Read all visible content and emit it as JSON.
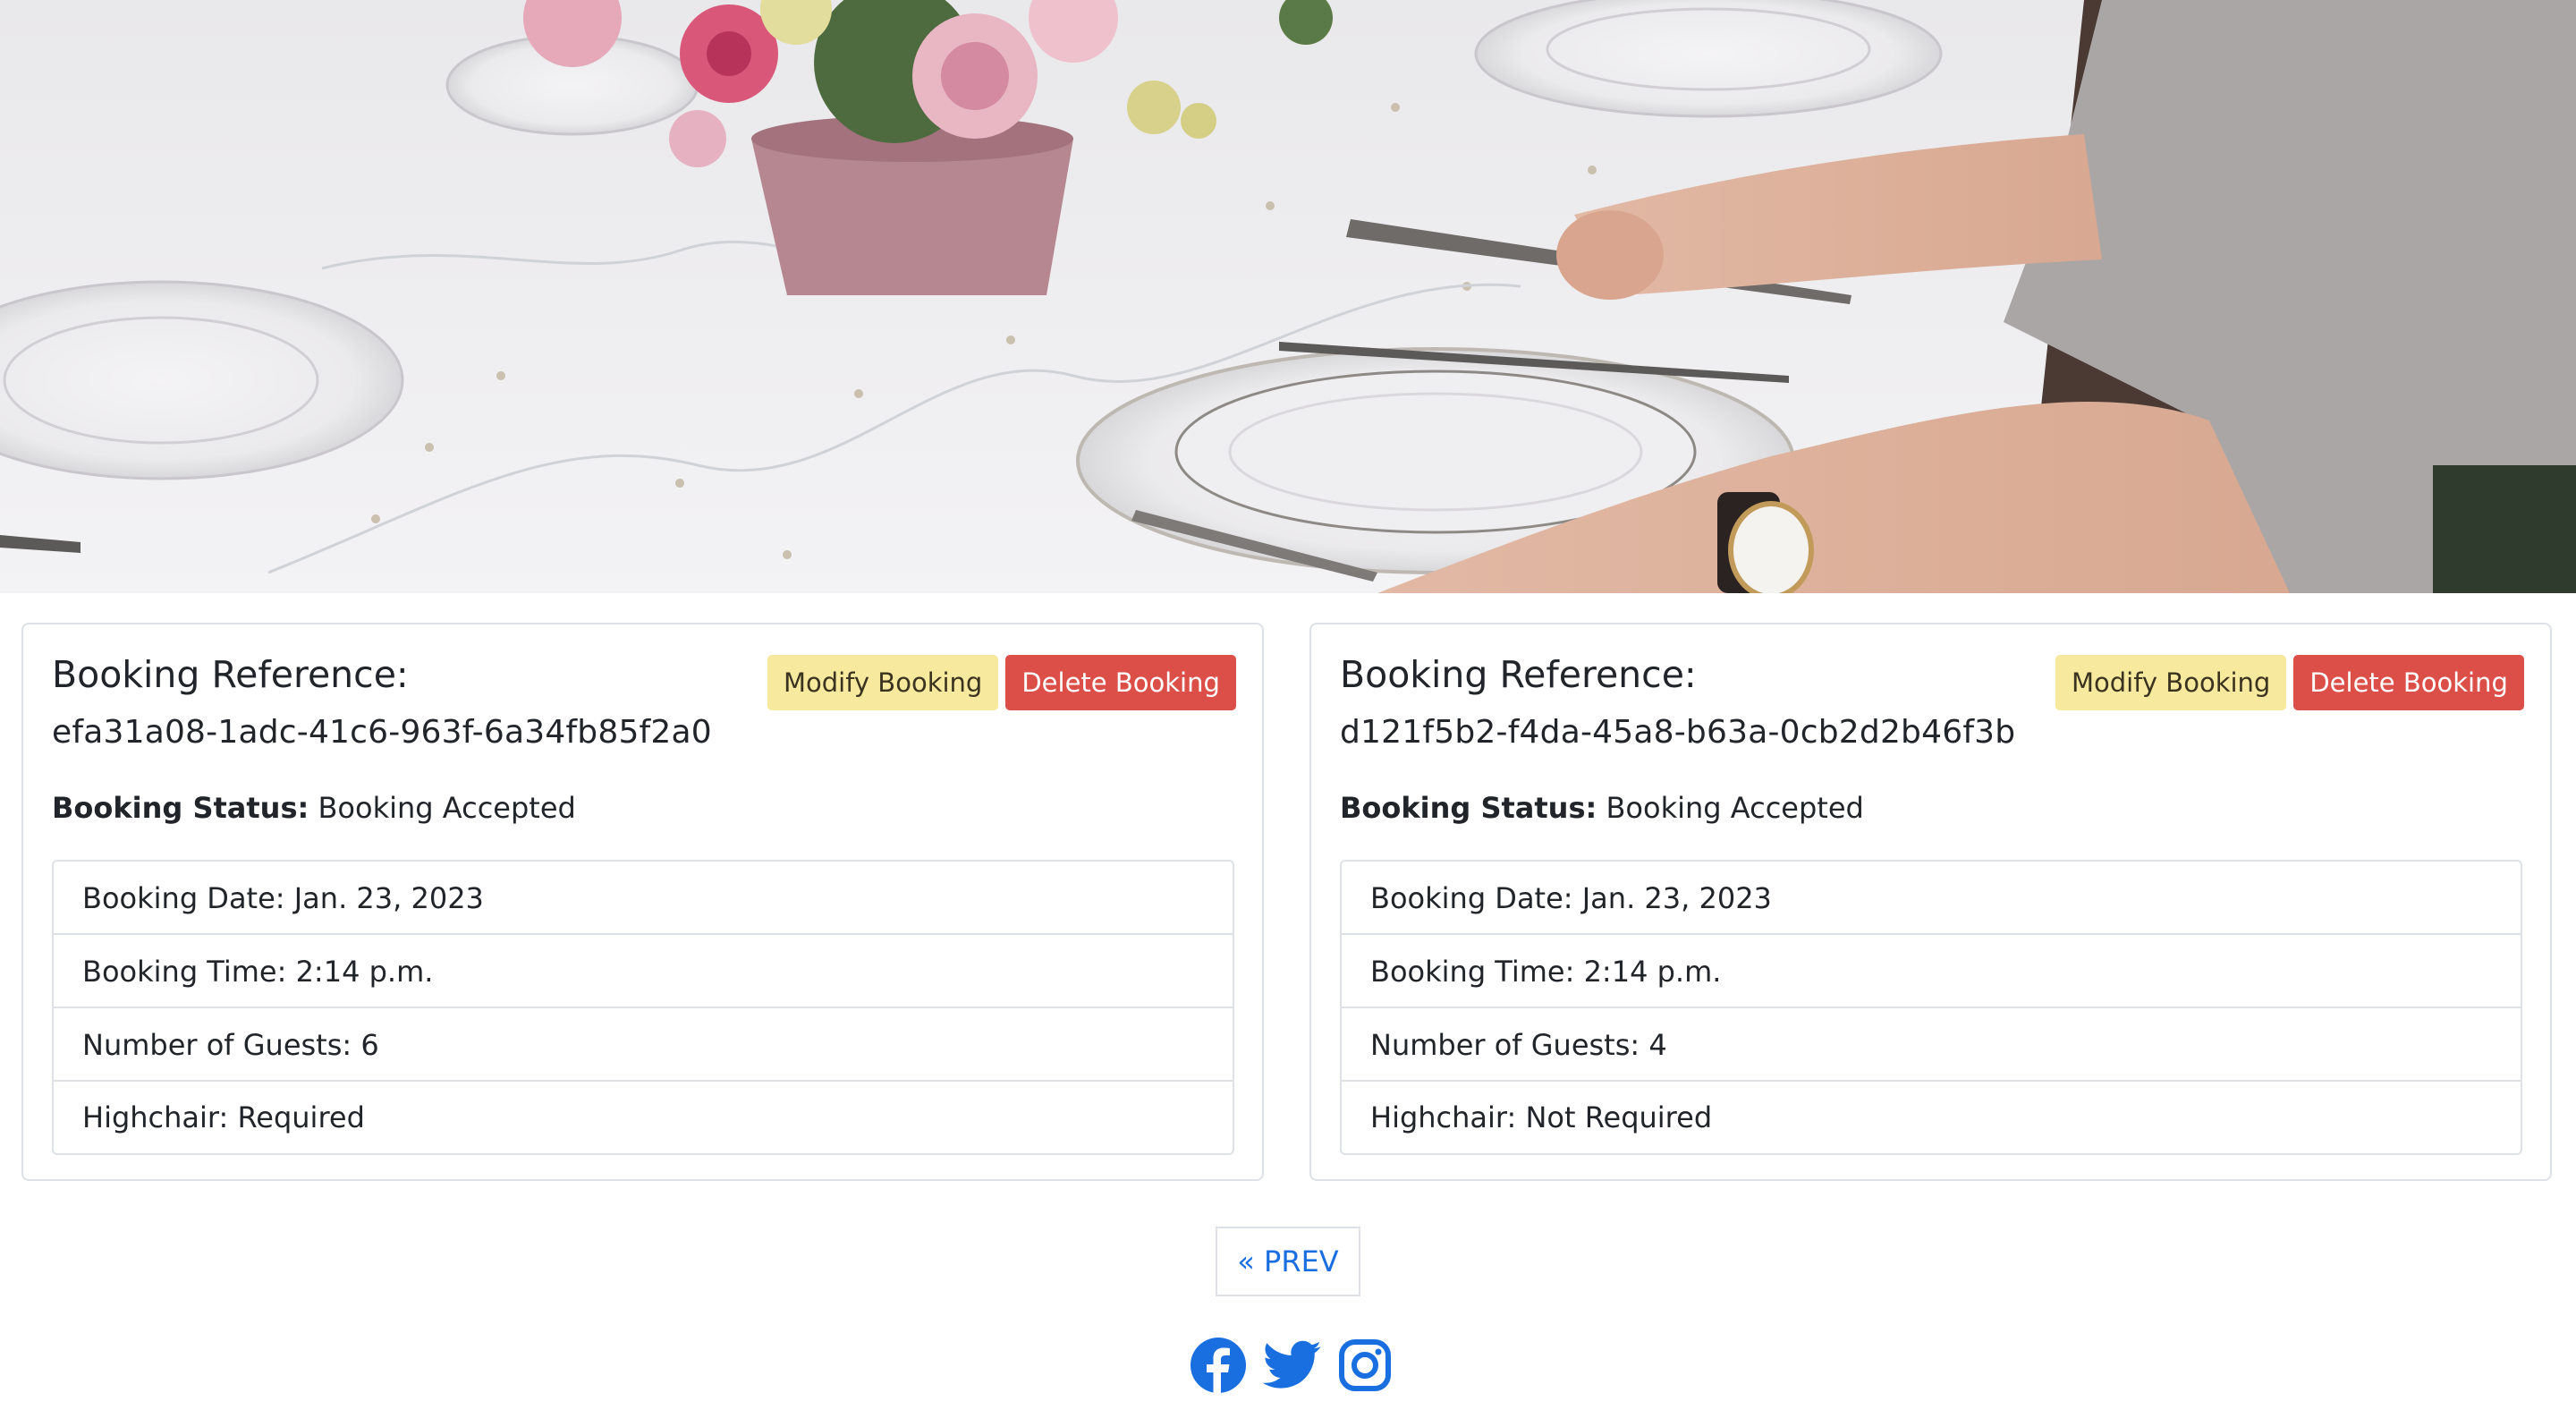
{
  "hero": {
    "description_icon": "table-setting-photo"
  },
  "bookings": [
    {
      "heading": "Booking Reference:",
      "reference": "efa31a08-1adc-41c6-963f-6a34fb85f2a0",
      "modify_label": "Modify Booking",
      "delete_label": "Delete Booking",
      "status_label": "Booking Status:",
      "status_value": "Booking Accepted",
      "details": [
        "Booking Date: Jan. 23, 2023",
        "Booking Time: 2:14 p.m.",
        "Number of Guests: 6",
        "Highchair: Required"
      ]
    },
    {
      "heading": "Booking Reference:",
      "reference": "d121f5b2-f4da-45a8-b63a-0cb2d2b46f3b",
      "modify_label": "Modify Booking",
      "delete_label": "Delete Booking",
      "status_label": "Booking Status:",
      "status_value": "Booking Accepted",
      "details": [
        "Booking Date: Jan. 23, 2023",
        "Booking Time: 2:14 p.m.",
        "Number of Guests: 4",
        "Highchair: Not Required"
      ]
    }
  ],
  "pagination": {
    "prev_label": "« PREV"
  },
  "social": {
    "icons": [
      "facebook-icon",
      "twitter-icon",
      "instagram-icon"
    ],
    "color": "#1a6fe0"
  },
  "colors": {
    "modify_button": "#f7e99e",
    "delete_button": "#dc4f49",
    "link": "#1a6fe0",
    "border": "#dee2e6"
  }
}
